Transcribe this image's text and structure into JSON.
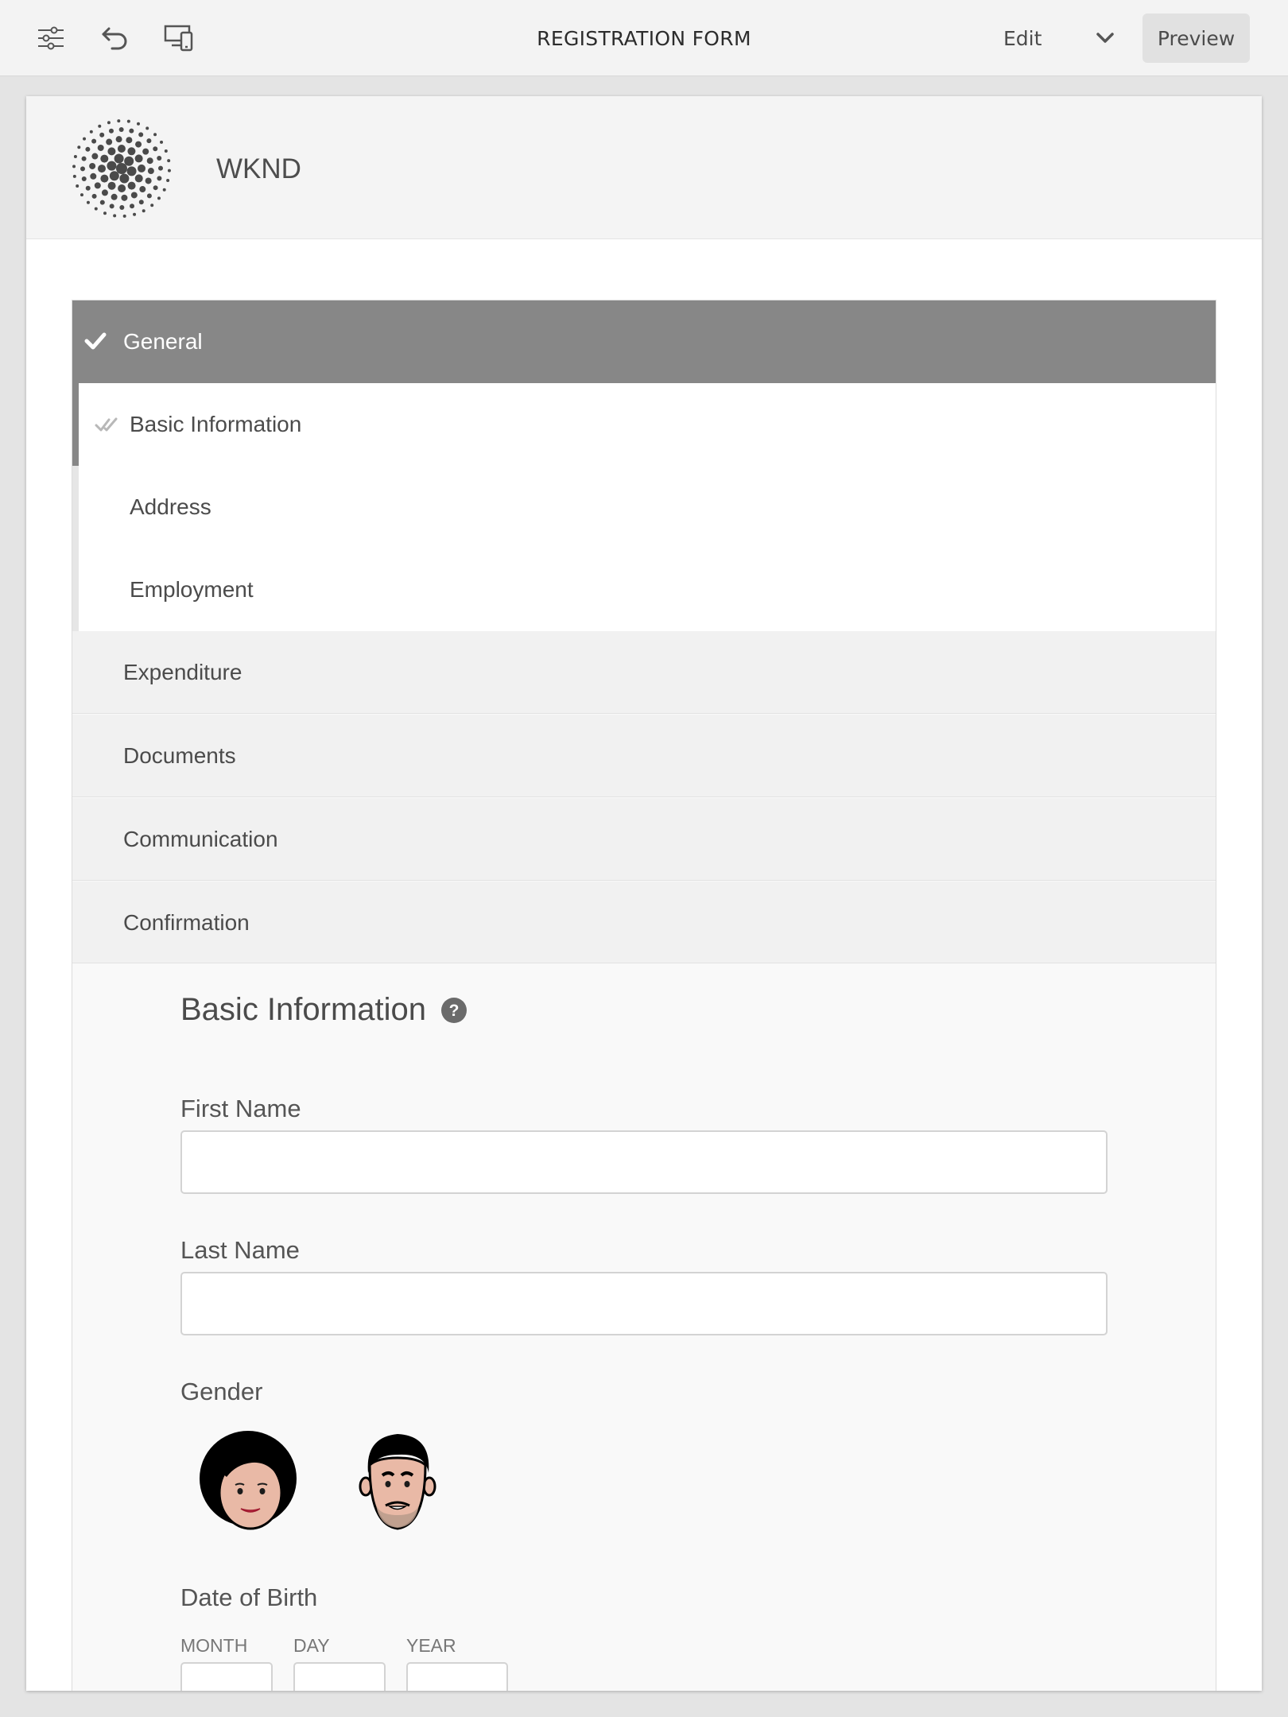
{
  "toolbar": {
    "title": "REGISTRATION FORM",
    "mode": "Edit",
    "preview_label": "Preview",
    "icons": [
      "sliders-icon",
      "undo-icon",
      "emulator-icon",
      "chevron-down-icon"
    ]
  },
  "header": {
    "brand": "WKND",
    "logo_icon": "dot-sphere-logo"
  },
  "wizard": {
    "active_section": {
      "label": "General",
      "status_icon": "checkmark-icon"
    },
    "subsections": [
      {
        "label": "Basic Information",
        "active": true,
        "status_icon": "double-check-icon"
      },
      {
        "label": "Address"
      },
      {
        "label": "Employment"
      }
    ],
    "sections": [
      {
        "label": "Expenditure"
      },
      {
        "label": "Documents"
      },
      {
        "label": "Communication"
      },
      {
        "label": "Confirmation"
      }
    ]
  },
  "form": {
    "title": "Basic Information",
    "help_icon": "question-mark-icon",
    "first_name": {
      "label": "First Name",
      "value": ""
    },
    "last_name": {
      "label": "Last Name",
      "value": ""
    },
    "gender": {
      "label": "Gender",
      "options": [
        "female-avatar",
        "male-avatar"
      ]
    },
    "dob": {
      "label": "Date of Birth",
      "month_label": "MONTH",
      "day_label": "DAY",
      "year_label": "YEAR"
    }
  },
  "colors": {
    "active_nav_bg": "#878787",
    "inactive_nav_bg": "#f1f1f1",
    "toolbar_bg": "#f3f3f3",
    "page_bg": "#e4e4e4"
  }
}
